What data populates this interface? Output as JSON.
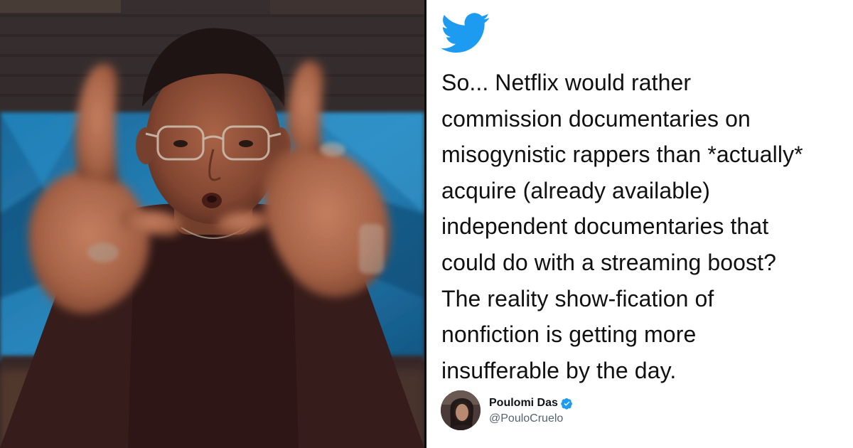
{
  "colors": {
    "twitter_blue": "#1D9BF0",
    "text": "#111111",
    "handle": "#536471",
    "divider": "#0b0b0b"
  },
  "photo": {
    "icon": "person-photo"
  },
  "tweet": {
    "logo_icon": "twitter-bird-icon",
    "text": "So... Netflix would rather\ncommission documentaries on\nmisogynistic rappers than *actually*\nacquire (already available)\nindependent documentaries that\ncould do with a streaming boost?\nThe reality show-fication of\nnonfiction is getting more\ninsufferable by the day.",
    "author": {
      "name": "Poulomi Das",
      "handle": "@PouloCruelo",
      "verified": true,
      "verified_icon": "verified-badge-icon"
    }
  }
}
